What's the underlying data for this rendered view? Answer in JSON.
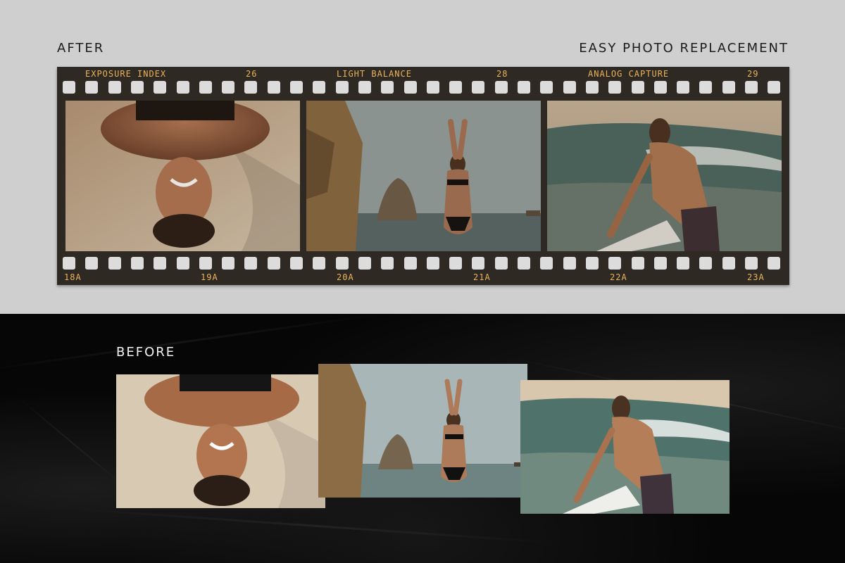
{
  "after_label": "AFTER",
  "tagline": "EASY PHOTO REPLACEMENT",
  "before_label": "BEFORE",
  "film_top_labels": [
    {
      "text": "EXPOSURE INDEX"
    },
    {
      "text": "26"
    },
    {
      "text": "LIGHT BALANCE"
    },
    {
      "text": "28"
    },
    {
      "text": "ANALOG CAPTURE"
    },
    {
      "text": "29"
    }
  ],
  "film_bottom_labels": [
    {
      "text": "18A"
    },
    {
      "text": "19A"
    },
    {
      "text": "20A"
    },
    {
      "text": "21A"
    },
    {
      "text": "22A"
    },
    {
      "text": "23A"
    }
  ],
  "photos": [
    {
      "subject": "woman lying in sand"
    },
    {
      "subject": "woman on beach with rocks"
    },
    {
      "subject": "surfer entering waves"
    }
  ],
  "colors": {
    "film_base": "#2f2924",
    "edge_text": "#e9b35a",
    "top_background": "#cfcfcf",
    "bottom_background": "#060606"
  }
}
